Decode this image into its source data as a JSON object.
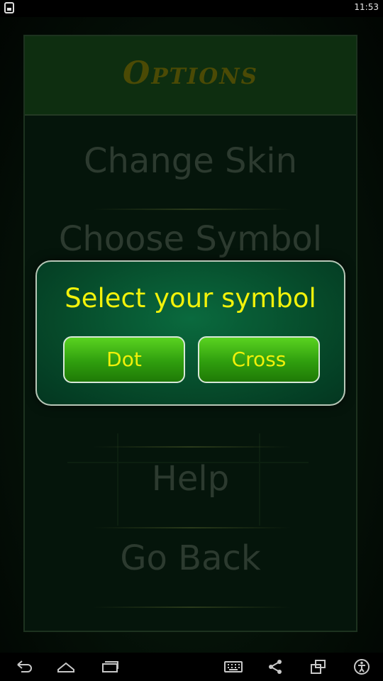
{
  "status_bar": {
    "time": "11:53",
    "app_icon": "notification-app-icon"
  },
  "header": {
    "title": "Options"
  },
  "menu": {
    "items": [
      {
        "label": "Change Skin"
      },
      {
        "label": "Choose Symbol"
      },
      {
        "label": "Help"
      },
      {
        "label": "Go Back"
      }
    ]
  },
  "dialog": {
    "title": "Select your symbol",
    "buttons": [
      {
        "label": "Dot"
      },
      {
        "label": "Cross"
      }
    ]
  },
  "nav_bar": {
    "icons": [
      "back-icon",
      "home-icon",
      "recent-apps-icon",
      "keyboard-icon",
      "share-icon",
      "screen-rotate-icon",
      "accessibility-icon"
    ]
  },
  "colors": {
    "dialog_title": "#f2f20a",
    "button_green": "#2f9e0e",
    "menu_text": "#2c3a2f",
    "header_title": "#4b4a05"
  }
}
